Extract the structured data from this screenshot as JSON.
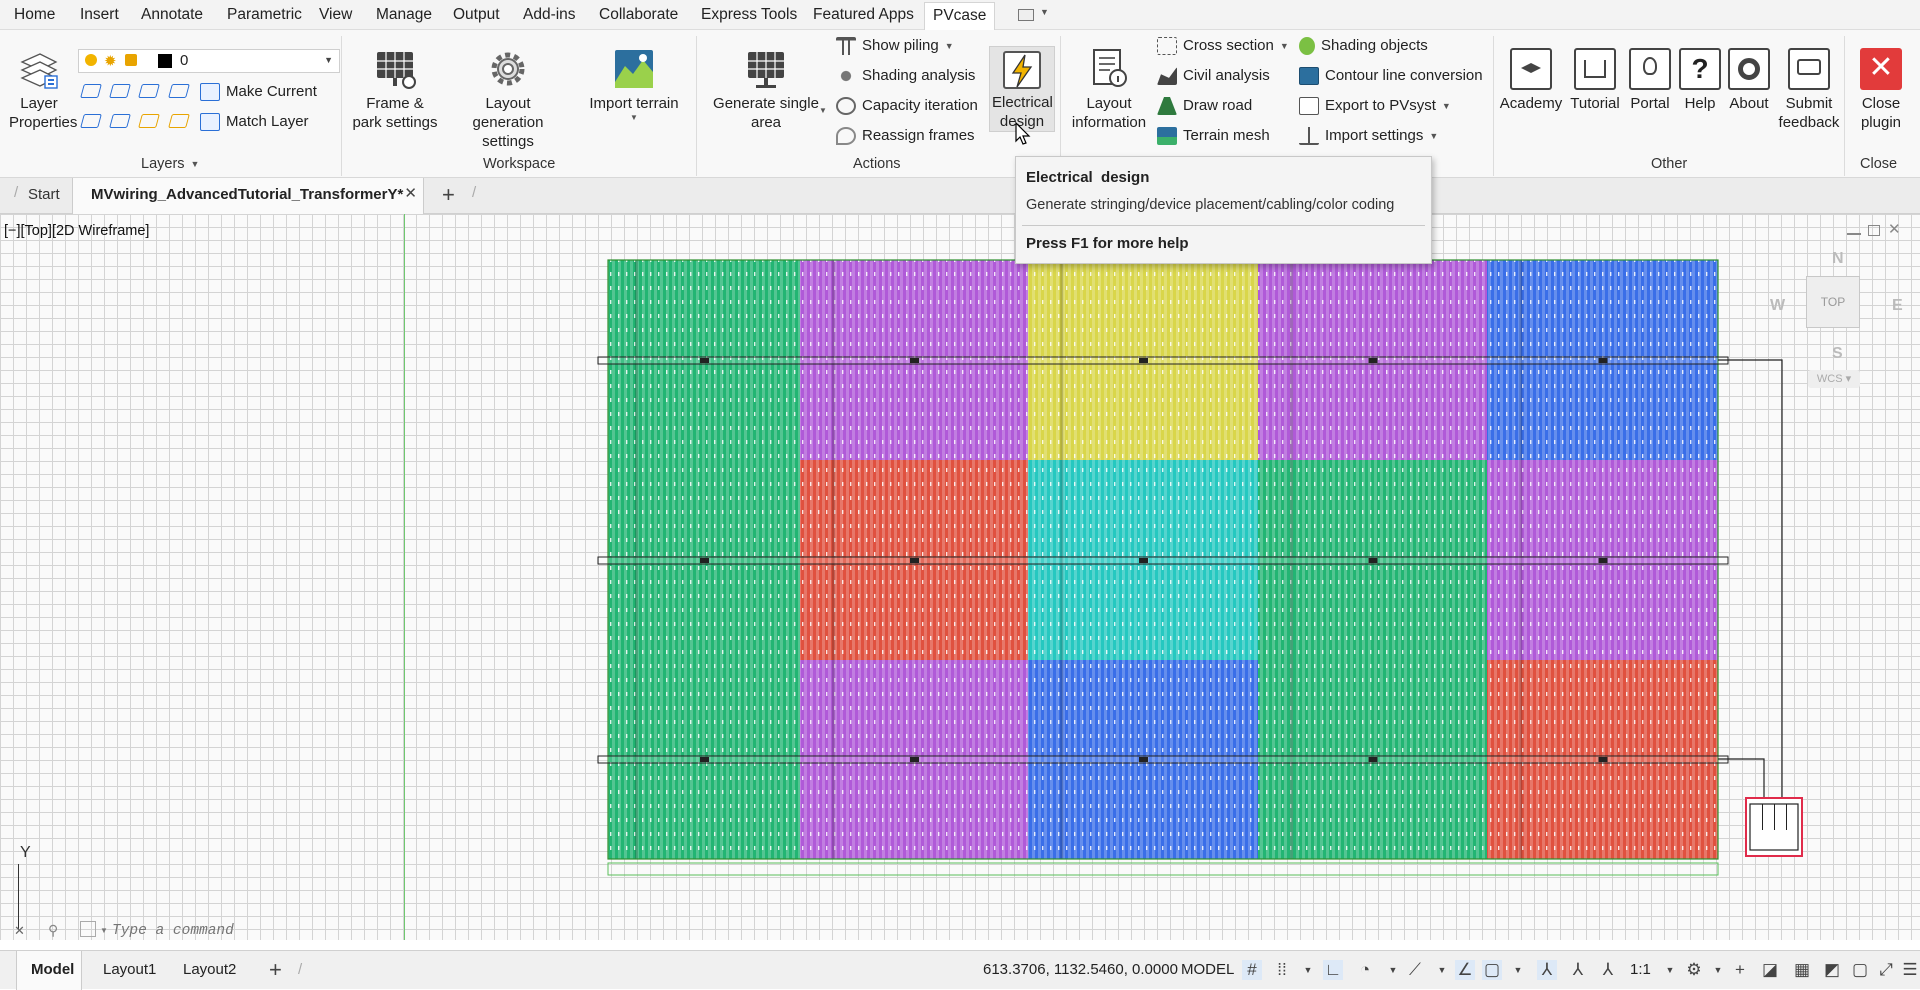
{
  "menu": {
    "tabs": [
      "Home",
      "Insert",
      "Annotate",
      "Parametric",
      "View",
      "Manage",
      "Output",
      "Add-ins",
      "Collaborate",
      "Express Tools",
      "Featured Apps",
      "PVcase"
    ]
  },
  "ribbon": {
    "layers": {
      "layer_properties": "Layer Properties",
      "layer_value": "0",
      "make_current": "Make Current",
      "match_layer": "Match Layer",
      "panel_label": "Layers"
    },
    "workspace": {
      "frame_park": "Frame & park settings",
      "layout_generation": "Layout generation settings",
      "import_terrain": "Import terrain",
      "panel_label": "Workspace"
    },
    "actions": {
      "generate_single": "Generate single area",
      "show_piling": "Show piling",
      "shading_analysis": "Shading analysis",
      "capacity_iteration": "Capacity iteration",
      "reassign_frames": "Reassign frames",
      "electrical_design": "Electrical design",
      "panel_label": "Actions"
    },
    "info": {
      "layout_information": "Layout information",
      "cross_section": "Cross section",
      "civil_analysis": "Civil analysis",
      "draw_road": "Draw road",
      "terrain_mesh": "Terrain mesh",
      "shading_objects": "Shading objects",
      "contour_line": "Contour line conversion",
      "export_pvsyst": "Export to PVsyst",
      "import_settings": "Import settings"
    },
    "other": {
      "academy": "Academy",
      "tutorial": "Tutorial",
      "portal": "Portal",
      "help": "Help",
      "about": "About",
      "submit_feedback": "Submit feedback",
      "panel_label": "Other"
    },
    "close": {
      "close_plugin": "Close plugin",
      "panel_label": "Close"
    }
  },
  "tooltip": {
    "title": "Electrical  design",
    "description": "Generate stringing/device placement/cabling/color coding",
    "help": "Press F1 for more help"
  },
  "doc_tabs": {
    "start": "Start",
    "active": "MVwiring_AdvancedTutorial_TransformerY*"
  },
  "viewport": {
    "label": "[−][Top][2D Wireframe]",
    "viewcube": {
      "top": "TOP",
      "north": "N",
      "south": "S",
      "east": "E",
      "west": "W",
      "ucs": "WCS"
    },
    "ucs_y": "Y"
  },
  "command": {
    "placeholder": "Type a command"
  },
  "status": {
    "layout_tabs": [
      "Model",
      "Layout1",
      "Layout2"
    ],
    "coords": "613.3706, 1132.5460, 0.0000",
    "space": "MODEL",
    "scale": "1:1"
  },
  "colors": {
    "ribbon_bg": "#f8f8f8",
    "menu_bg": "#f3f3f3",
    "grid": "#d4d4d4",
    "module_green": "#22b573",
    "module_yellow": "#d9d64a",
    "module_blue": "#3a6ee8",
    "module_red": "#e0513f",
    "module_purple": "#b05ad8",
    "module_cyan": "#25c8c0",
    "close_red": "#e23b3b"
  }
}
